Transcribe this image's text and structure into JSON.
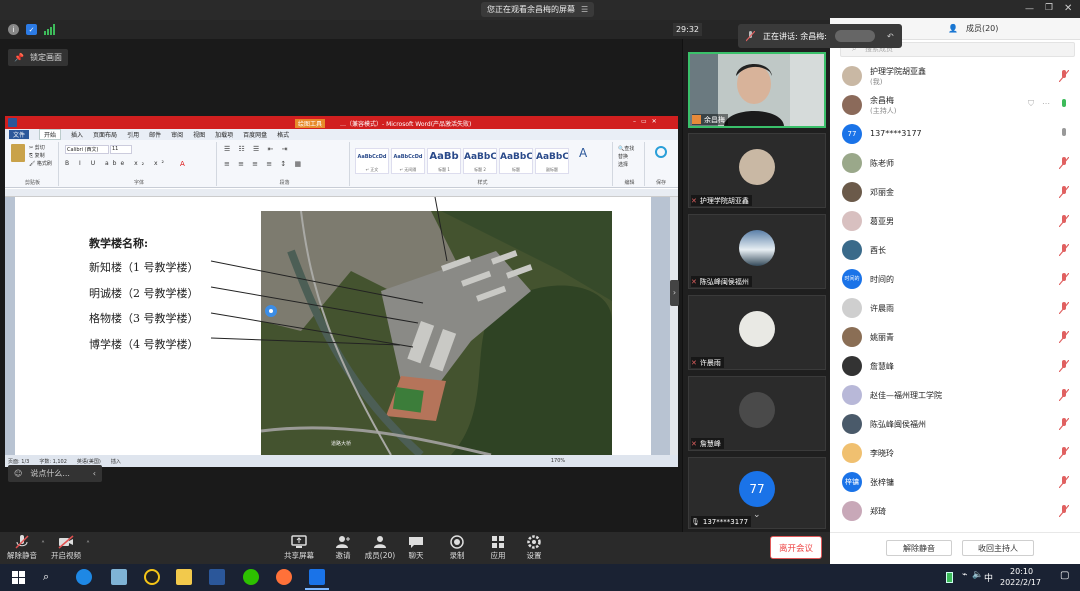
{
  "top_bar": {
    "notice": "您正在观看余昌梅的屏幕"
  },
  "info_bar": {
    "timer": "29:32",
    "speaking_label": "正在讲话: 余昌梅:"
  },
  "lock_label": "锁定画面",
  "chat_placeholder": "说点什么...",
  "word": {
    "title": "…（兼容模式）- Microsoft Word(产品激活失败)",
    "tool_tab": "绘图工具",
    "tabs": [
      "文件",
      "开始",
      "插入",
      "页面布局",
      "引用",
      "邮件",
      "审阅",
      "视图",
      "加载项",
      "百度网盘",
      "格式"
    ],
    "groups": [
      "剪贴板",
      "字体",
      "段落",
      "样式",
      "编辑",
      "保存"
    ],
    "font_name": "Calibri (西文)",
    "font_size": "11",
    "styles": [
      {
        "sample": "AaBbCcDd",
        "name": "↵ 正文"
      },
      {
        "sample": "AaBbCcDd",
        "name": "↵ 无间隔"
      },
      {
        "sample": "AaBb",
        "name": "标题 1"
      },
      {
        "sample": "AaBbC",
        "name": "标题 2"
      },
      {
        "sample": "AaBbC",
        "name": "标题"
      },
      {
        "sample": "AaBbC",
        "name": "副标题"
      }
    ],
    "status": {
      "page": "页面: 1/3",
      "words": "字数: 1,102",
      "lang": "英语(美国)",
      "mode": "插入",
      "zoom": "170%"
    },
    "doc": {
      "heading": "教学楼名称:",
      "items": [
        "新知楼（1 号教学楼）",
        "明诚楼（2 号教学楼）",
        "格物楼（3 号教学楼）",
        "博学楼（4 号教学楼）"
      ],
      "map_road": "道路大桥"
    }
  },
  "video_tiles": [
    {
      "name": "余昌梅"
    },
    {
      "name": "护理学院胡亚鑫"
    },
    {
      "name": "陈弘峰闽侯福州"
    },
    {
      "name": "许晨雨"
    },
    {
      "name": "詹慧峰"
    },
    {
      "name": "137****3177",
      "avatar_text": "77"
    }
  ],
  "panel": {
    "tab_members": "成员(20)",
    "search_placeholder": "搜索成员",
    "members": [
      {
        "name": "护理学院胡亚鑫",
        "role": "(我)"
      },
      {
        "name": "余昌梅",
        "role": "(主持人)"
      },
      {
        "name": "137****3177",
        "avatar_text": "77"
      },
      {
        "name": "陈老师"
      },
      {
        "name": "邓丽金"
      },
      {
        "name": "葛亚男"
      },
      {
        "name": "酉长"
      },
      {
        "name": "时间的",
        "avatar_text": "时间的"
      },
      {
        "name": "许晨雨"
      },
      {
        "name": "姚丽青"
      },
      {
        "name": "詹慧峰"
      },
      {
        "name": "赵佳—福州理工学院"
      },
      {
        "name": "陈弘峰闽侯福州"
      },
      {
        "name": "李晓玲"
      },
      {
        "name": "张梓镛",
        "avatar_text": "梓镛"
      },
      {
        "name": "郑琦"
      }
    ],
    "btn_unmute_all": "解除静音",
    "btn_reclaim_host": "收回主持人"
  },
  "toolbar": {
    "unmute": "解除静音",
    "video": "开启视频",
    "share": "共享屏幕",
    "invite": "邀请",
    "members": "成员(20)",
    "chat": "聊天",
    "record": "录制",
    "apps": "应用",
    "settings": "设置",
    "leave": "离开会议"
  },
  "taskbar": {
    "ime": "中",
    "time": "20:10",
    "date": "2022/2/17"
  },
  "colors": {
    "word_red": "#d11f1f",
    "accent_blue": "#1a73e8",
    "leave_red": "#e44444",
    "muted_red": "#e06060"
  }
}
